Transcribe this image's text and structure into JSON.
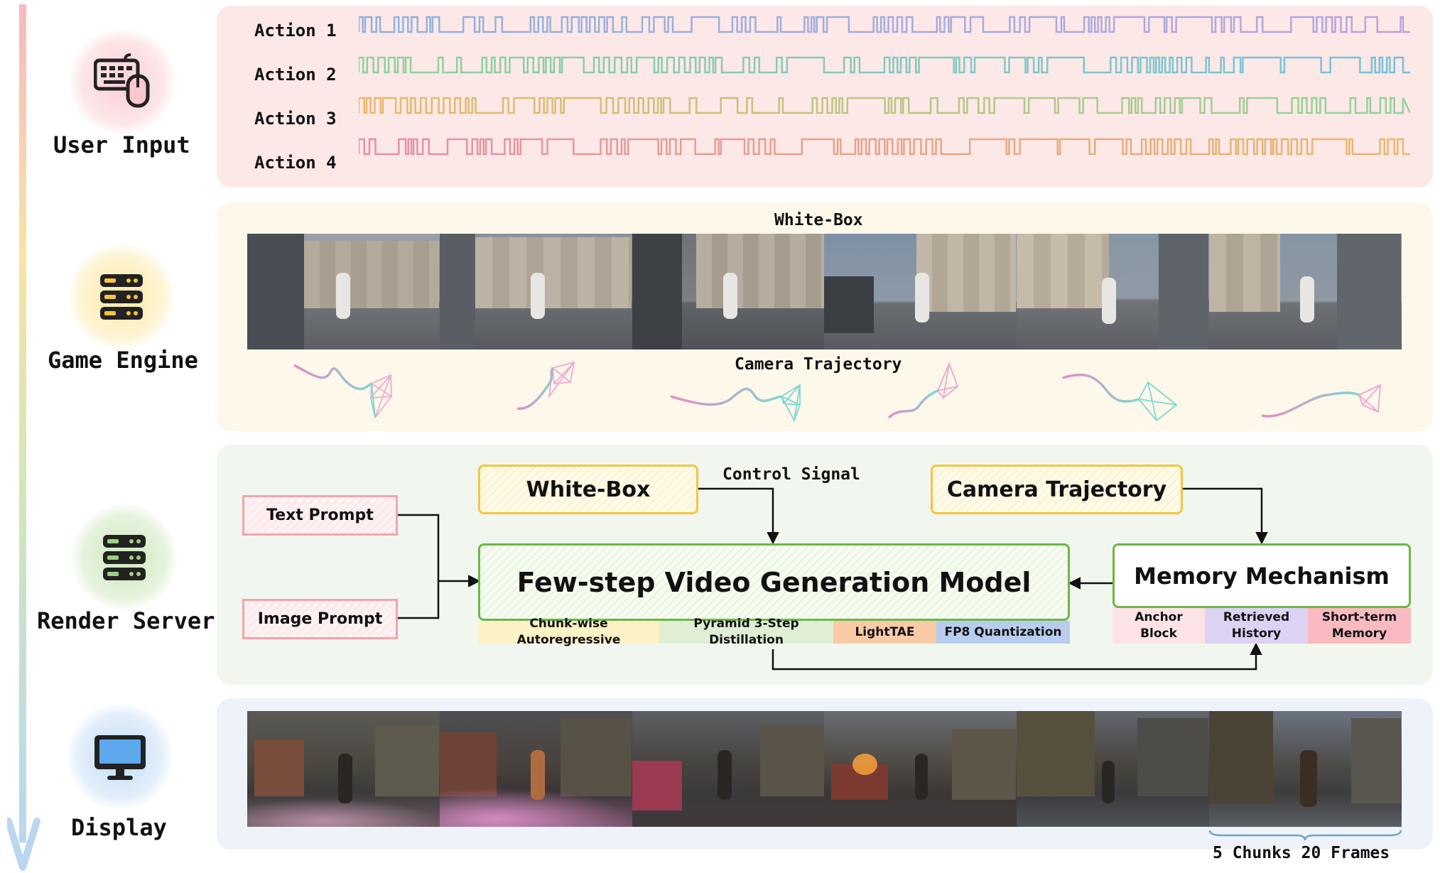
{
  "stages": {
    "user_input": "User Input",
    "game_engine": "Game Engine",
    "render_server": "Render Server",
    "display": "Display"
  },
  "actions": [
    "Action 1",
    "Action 2",
    "Action 3",
    "Action 4"
  ],
  "game_engine": {
    "whitebox_title": "White-Box",
    "camera_title": "Camera Trajectory"
  },
  "render_server": {
    "text_prompt": "Text Prompt",
    "image_prompt": "Image Prompt",
    "whitebox": "White-Box",
    "control_signal": "Control Signal",
    "camera_trajectory": "Camera Trajectory",
    "model": "Few-step Video Generation Model",
    "model_tags": [
      "Chunk-wise Autoregressive",
      "Pyramid 3-Step Distillation",
      "LightTAE",
      "FP8 Quantization"
    ],
    "memory": "Memory Mechanism",
    "memory_tags": [
      "Anchor Block",
      "Retrieved History",
      "Short-term Memory"
    ]
  },
  "display": {
    "caption": "5 Chunks 20 Frames"
  },
  "colors": {
    "user_input_panel": "#fde8e8",
    "game_engine_panel": "#fdf8ea",
    "render_server_panel": "#f1f7ee",
    "display_panel": "#eef3f9",
    "red_accent": "#f2a4ad",
    "yellow_accent": "#f4c542",
    "green_accent": "#6cb64a"
  },
  "icons": [
    "keyboard-mouse-icon",
    "server-icon",
    "server-icon",
    "monitor-icon"
  ]
}
